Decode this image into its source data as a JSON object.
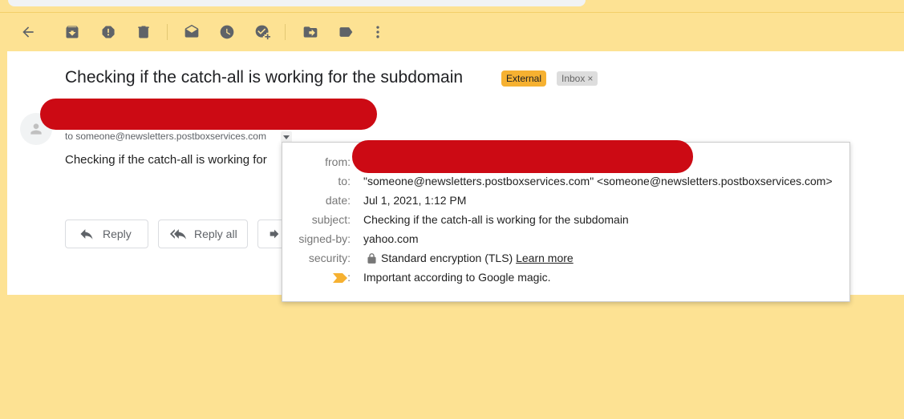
{
  "toolbar": {
    "icons": [
      "back-arrow-icon",
      "archive-icon",
      "report-spam-icon",
      "delete-icon",
      "mark-unread-icon",
      "snooze-icon",
      "add-to-tasks-icon",
      "move-to-icon",
      "label-icon",
      "more-icon"
    ]
  },
  "email": {
    "subject": "Checking if the catch-all is working for the subdomain",
    "labels": {
      "external": "External",
      "inbox": "Inbox",
      "remove": "×"
    },
    "to_line": "to someone@newsletters.postboxservices.com",
    "body": "Checking if the catch-all is working for"
  },
  "actions": {
    "reply": "Reply",
    "reply_all": "Reply all"
  },
  "details": {
    "from_label": "from:",
    "to_label": "to:",
    "to_value": "\"someone@newsletters.postboxservices.com\" <someone@newsletters.postboxservices.com>",
    "date_label": "date:",
    "date_value": "Jul 1, 2021, 1:12 PM",
    "subject_label": "subject:",
    "subject_value": "Checking if the catch-all is working for the subdomain",
    "signed_label": "signed-by:",
    "signed_value": "yahoo.com",
    "security_label": "security:",
    "security_value": "Standard encryption (TLS)",
    "learn_more": "Learn more",
    "importance_colon": ":",
    "importance_value": "Important according to Google magic."
  },
  "colors": {
    "page_bg": "#fde293",
    "redaction": "#cc0a14",
    "external_chip": "#f6b131",
    "importance_marker": "#f6b131"
  }
}
